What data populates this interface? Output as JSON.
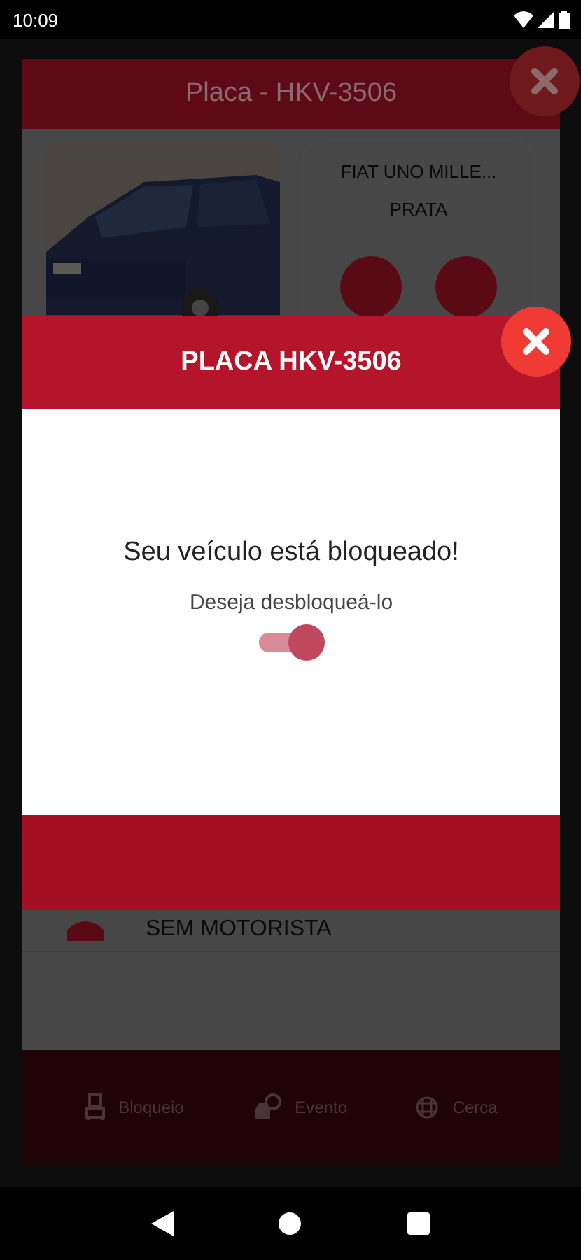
{
  "status_bar": {
    "time": "10:09"
  },
  "background": {
    "title": "Placa - HKV-3506",
    "vehicle": {
      "model": "FIAT UNO MILLE...",
      "color_name": "PRATA"
    },
    "list_item": "SEM MOTORISTA",
    "bottom_nav": [
      {
        "label": "Bloqueio",
        "kind": "lock"
      },
      {
        "label": "Evento",
        "kind": "event"
      },
      {
        "label": "Cerca",
        "kind": "fence"
      }
    ]
  },
  "modal": {
    "title": "PLACA HKV-3506",
    "message": "Seu veículo está bloqueado!",
    "prompt": "Deseja desbloqueá-lo",
    "toggle": {
      "on": true
    }
  }
}
